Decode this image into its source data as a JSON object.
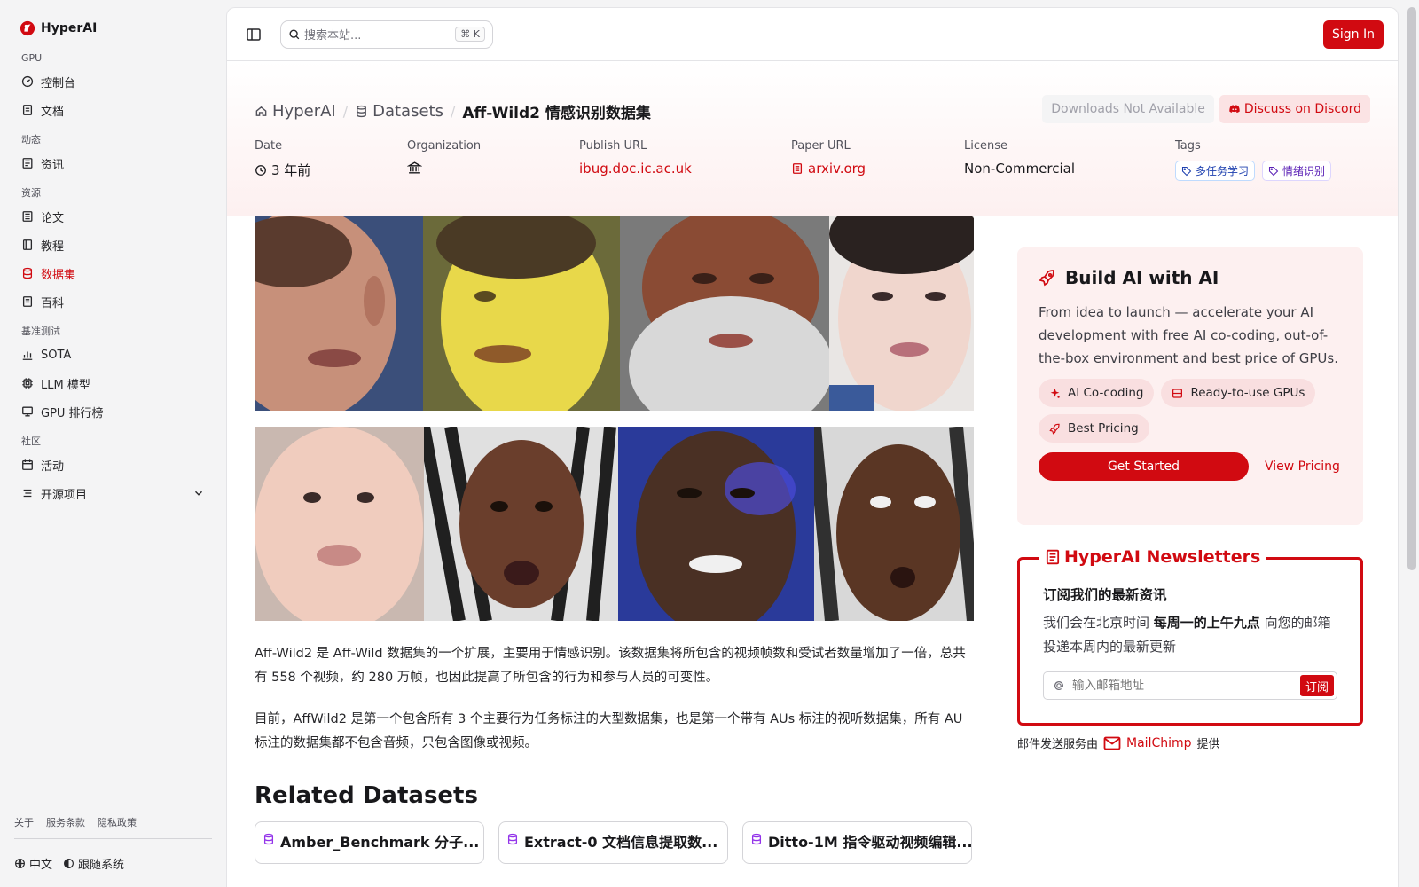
{
  "brand": {
    "name": "HyperAI"
  },
  "sidebar": {
    "groups": [
      {
        "label": "GPU",
        "items": [
          {
            "label": "控制台",
            "icon": "gauge-icon"
          },
          {
            "label": "文档",
            "icon": "doc-icon"
          }
        ]
      },
      {
        "label": "动态",
        "items": [
          {
            "label": "资讯",
            "icon": "news-icon"
          }
        ]
      },
      {
        "label": "资源",
        "items": [
          {
            "label": "论文",
            "icon": "paper-icon"
          },
          {
            "label": "教程",
            "icon": "book-icon"
          },
          {
            "label": "数据集",
            "icon": "database-icon",
            "active": true
          },
          {
            "label": "百科",
            "icon": "wiki-icon"
          }
        ]
      },
      {
        "label": "基准测试",
        "items": [
          {
            "label": "SOTA",
            "icon": "chart-icon"
          },
          {
            "label": "LLM 模型",
            "icon": "cpu-icon"
          },
          {
            "label": "GPU 排行榜",
            "icon": "monitor-icon"
          }
        ]
      },
      {
        "label": "社区",
        "items": [
          {
            "label": "活动",
            "icon": "calendar-icon"
          },
          {
            "label": "开源项目",
            "icon": "list-icon"
          }
        ]
      }
    ],
    "footer_links": [
      "关于",
      "服务条款",
      "隐私政策"
    ],
    "language": "中文",
    "theme": "跟随系统"
  },
  "topbar": {
    "search_placeholder": "搜索本站...",
    "shortcut": "⌘ K",
    "sign_in": "Sign In"
  },
  "breadcrumb": {
    "home": "HyperAI",
    "section": "Datasets",
    "current": "Aff-Wild2 情感识别数据集"
  },
  "actions": {
    "downloads": "Downloads Not Available",
    "discord": "Discuss on Discord"
  },
  "meta": {
    "date_label": "Date",
    "date_value": "3 年前",
    "org_label": "Organization",
    "publish_label": "Publish URL",
    "publish_value": "ibug.doc.ic.ac.uk",
    "paper_label": "Paper URL",
    "paper_value": "arxiv.org",
    "license_label": "License",
    "license_value": "Non-Commercial",
    "tags_label": "Tags",
    "tags": [
      "多任务学习",
      "情绪识别"
    ]
  },
  "description": [
    "Aff-Wild2 是 Aff-Wild 数据集的一个扩展，主要用于情感识别。该数据集将所包含的视频帧数和受试者数量增加了一倍，总共有 558 个视频，约 280 万帧，也因此提高了所包含的行为和参与人员的可变性。",
    "目前，AffWild2 是第一个包含所有 3 个主要行为任务标注的大型数据集，也是第一个带有 AUs 标注的视听数据集，所有 AU 标注的数据集都不包含音频，只包含图像或视频。"
  ],
  "related": {
    "title": "Related Datasets",
    "cards": [
      "Amber_Benchmark 分子...",
      "Extract-0 文档信息提取数...",
      "Ditto-1M 指令驱动视频编辑..."
    ]
  },
  "promo": {
    "title": "Build AI with AI",
    "text": "From idea to launch — accelerate your AI development with free AI co-coding, out-of-the-box environment and best price of GPUs.",
    "chips": [
      "AI Co-coding",
      "Ready-to-use GPUs",
      "Best Pricing"
    ],
    "cta": "Get Started",
    "secondary": "View Pricing"
  },
  "newsletter": {
    "title": "HyperAI Newsletters",
    "heading": "订阅我们的最新资讯",
    "text_before": "我们会在北京时间 ",
    "text_bold": "每周一的上午九点",
    "text_after": " 向您的邮箱投递本周内的最新更新",
    "input_placeholder": "输入邮箱地址",
    "subscribe": "订阅",
    "provider_prefix": "邮件发送服务由",
    "provider": "MailChimp",
    "provider_suffix": "提供"
  },
  "colors": {
    "accent": "#d10a11",
    "hero_bg": "#fdf0f0"
  }
}
